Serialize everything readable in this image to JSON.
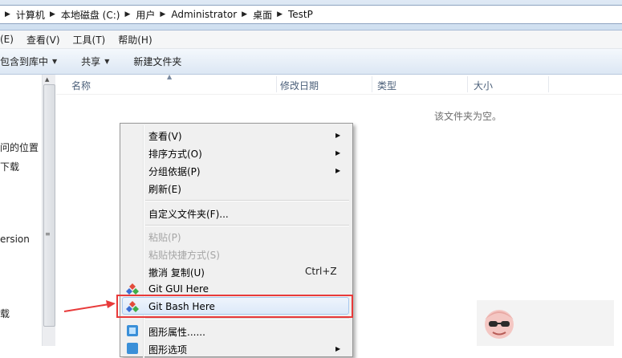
{
  "address": {
    "crumbs": [
      "计算机",
      "本地磁盘 (C:)",
      "用户",
      "Administrator",
      "桌面",
      "TestP"
    ]
  },
  "menubar": {
    "items": [
      "(E)",
      "查看(V)",
      "工具(T)",
      "帮助(H)"
    ]
  },
  "toolbar": {
    "include_library": "包含到库中",
    "share": "共享",
    "new_folder": "新建文件夹"
  },
  "navpane": {
    "items": [
      "问的位置",
      "下载",
      "ersion",
      "载"
    ]
  },
  "columns": {
    "name": "名称",
    "modified": "修改日期",
    "type": "类型",
    "size": "大小"
  },
  "empty_message": "该文件夹为空。",
  "context_menu": {
    "view": "查看(V)",
    "sort": "排序方式(O)",
    "group": "分组依据(P)",
    "refresh": "刷新(E)",
    "customize": "自定义文件夹(F)...",
    "paste": "粘贴(P)",
    "paste_shortcut": "粘贴快捷方式(S)",
    "undo": "撤消 复制(U)",
    "undo_shortcut": "Ctrl+Z",
    "git_gui": "Git GUI Here",
    "git_bash": "Git Bash Here",
    "graphics_props": "图形属性......",
    "graphics_options": "图形选项"
  },
  "colors": {
    "highlight_box": "#e83a3a",
    "arrow": "#e83a3a",
    "menu_bg": "#f0f0f0"
  }
}
